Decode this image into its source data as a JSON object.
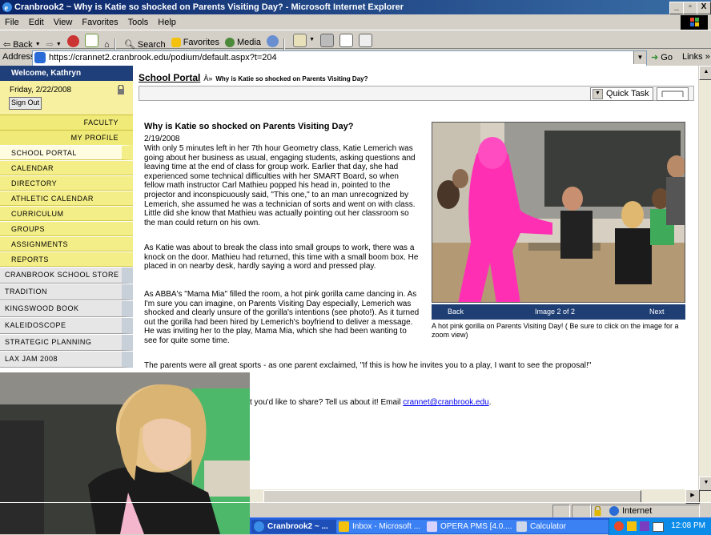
{
  "window": {
    "title": "Cranbrook2 ~ Why is Katie so shocked on Parents Visiting Day? - Microsoft Internet Explorer",
    "minimize": "_",
    "maximize": "â€‚",
    "close": "X"
  },
  "menu": [
    "File",
    "Edit",
    "View",
    "Favorites",
    "Tools",
    "Help"
  ],
  "toolbar": {
    "back": "Back",
    "search": "Search",
    "favorites": "Favorites",
    "media": "Media"
  },
  "address": {
    "label": "Address",
    "url": "https://crannet2.cranbrook.edu/podium/default.aspx?t=204",
    "go": "Go",
    "links": "Links"
  },
  "sidebar": {
    "welcome": "Welcome, Kathryn",
    "date": "Friday, 2/22/2008",
    "sign_out": "Sign Out",
    "role_links": [
      "FACULTY",
      "MY PROFILE"
    ],
    "nav": [
      "SCHOOL PORTAL",
      "CALENDAR",
      "DIRECTORY",
      "ATHLETIC CALENDAR",
      "CURRICULUM",
      "GROUPS",
      "ASSIGNMENTS",
      "REPORTS"
    ],
    "sites": [
      "CRANBROOK SCHOOL STORE",
      "TRADITION",
      "KINGSWOOD BOOK",
      "KALEIDOSCOPE",
      "STRATEGIC PLANNING",
      "LAX JAM 2008"
    ]
  },
  "breadcrumb": {
    "link": "School Portal",
    "sep": "Â»",
    "title": "Why is Katie so shocked on Parents Visiting Day?"
  },
  "quick_task": "Quick Task",
  "article": {
    "title": "Why is Katie so shocked on Parents Visiting Day?",
    "date": "2/19/2008",
    "p1": "With only 5 minutes left in her 7th hour Geometry class, Katie Lemerich was going about her business as usual, engaging students, asking questions and leaving time at the end of class for group work.  Earlier that day, she had experienced some technical difficulties with her SMART Board, so when fellow math instructor Carl Mathieu popped his head in, pointed to the projector and inconspicuously said, \"This one,\" to an man unrecognized by Lemerich, she assumed he was a technician of sorts and went on with class.  Little did she know that Mathieu was actually pointing out her classroom so the man could return on his own.",
    "p2": "As Katie was about to break the class into small groups to work, there was a knock on the door.  Mathieu had returned, this time with a small boom box.  He placed in on nearby desk, hardly saying a word and pressed play.",
    "p3": "As ABBA's \"Mama Mia\" filled the room, a hot pink gorilla came dancing in.  As I'm sure you can imagine, on Parents Visiting Day especially, Lemerich was shocked and clearly unsure of the gorilla's intentions (see photo!).  As it turned out the gorilla had been hired by Lemerich's boyfriend to deliver a message.  He was inviting her to the play, Mama Mia, which she had been wanting to see for quite some time.",
    "p4": "The parents were all great sports - as one parent exclaimed, \"If this is how he invites you to a play, I want to see the proposal!\"",
    "p5_prefix": "t you'd like to share?  Tell us about it!  Email ",
    "email": "crannet@cranbrook.edu",
    "p5_suffix": "."
  },
  "viewer": {
    "back": "Back",
    "counter": "Image 2 of 2",
    "next": "Next",
    "caption": "A hot pink gorilla on Parents Visiting Day! ( Be sure to click on the image for a zoom view)"
  },
  "status": {
    "zone": "Internet"
  },
  "taskbar": {
    "tasks": [
      "Cranbrook2 ~ ...",
      "Inbox - Microsoft ...",
      "OPERA PMS [4.0....",
      "Calculator"
    ],
    "clock": "12:08 PM"
  },
  "colors": {
    "title_bar": "#0a246a",
    "sidebar_yellow": "#f4ee88",
    "sidebar_header": "#1f3f7a",
    "viewer_nav": "#1e3e74",
    "gorilla_pink": "#ff2fb4",
    "taskbar": "#245edb"
  }
}
